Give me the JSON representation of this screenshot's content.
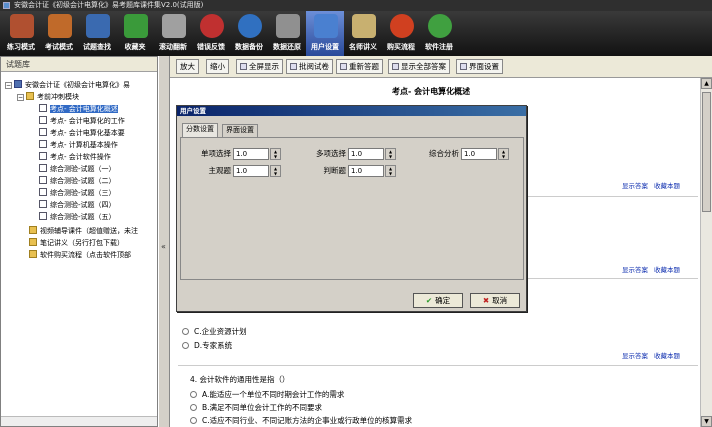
{
  "window": {
    "title": "安徽会计证《初级会计电算化》易考题库课件集V2.0(试用版)"
  },
  "toolbar": {
    "items": [
      {
        "label": "练习模式",
        "icon": "books-icon",
        "color": "#b05030"
      },
      {
        "label": "考试模式",
        "icon": "exam-chair-icon",
        "color": "#c06a2a"
      },
      {
        "label": "试题查找",
        "icon": "search-magnifier-icon",
        "color": "#3a6ab0"
      },
      {
        "label": "收藏夹",
        "icon": "favorites-book-icon",
        "color": "#3a9a3a"
      },
      {
        "label": "滚动翻新",
        "icon": "scroll-refresh-icon",
        "color": "#a0a0a0"
      },
      {
        "label": "错误反馈",
        "icon": "error-feedback-icon",
        "color": "#c03030"
      },
      {
        "label": "数据备份",
        "icon": "globe-backup-icon",
        "color": "#3070c0"
      },
      {
        "label": "数据还原",
        "icon": "restore-arrows-icon",
        "color": "#909090"
      },
      {
        "label": "用户设置",
        "icon": "user-settings-icon",
        "color": "#4a80d0"
      },
      {
        "label": "名师讲义",
        "icon": "lecture-notes-icon",
        "color": "#c8b070"
      },
      {
        "label": "购买流程",
        "icon": "internet-explorer-icon",
        "color": "#d04020"
      },
      {
        "label": "软件注册",
        "icon": "users-register-icon",
        "color": "#40a040"
      }
    ]
  },
  "tree": {
    "title": "试题库",
    "nodes": [
      {
        "label": "安徽会计证《初级会计电算化》易",
        "type": "book",
        "indent": 0,
        "expand": "−"
      },
      {
        "label": "考前冲刺模块",
        "type": "folder",
        "indent": 1,
        "expand": "−"
      },
      {
        "label": "考点-  会计电算化概述",
        "type": "page",
        "indent": 2,
        "selected": true
      },
      {
        "label": "考点-  会计电算化的工作",
        "type": "page",
        "indent": 2
      },
      {
        "label": "考点-  会计电算化基本要",
        "type": "page",
        "indent": 2
      },
      {
        "label": "考点-  计算机基本操作",
        "type": "page",
        "indent": 2
      },
      {
        "label": "考点-  会计软件操作",
        "type": "page",
        "indent": 2
      },
      {
        "label": "综合测验-试题（一）",
        "type": "page",
        "indent": 2
      },
      {
        "label": "综合测验-试题（二）",
        "type": "page",
        "indent": 2
      },
      {
        "label": "综合测验-试题（三）",
        "type": "page",
        "indent": 2
      },
      {
        "label": "综合测验-试题（四）",
        "type": "page",
        "indent": 2
      },
      {
        "label": "综合测验-试题（五）",
        "type": "page",
        "indent": 2
      },
      {
        "label": "视频辅导课件（超值赠送，未注",
        "type": "folder",
        "indent": 1
      },
      {
        "label": "笔记讲义（另行打包下载）",
        "type": "folder",
        "indent": 1
      },
      {
        "label": "软件购买流程（点击软件顶部",
        "type": "folder",
        "indent": 1
      }
    ]
  },
  "splitter": {
    "glyph": "«"
  },
  "content_toolbar": {
    "buttons": [
      {
        "label": "放大",
        "icon": ""
      },
      {
        "label": "缩小",
        "icon": ""
      },
      {
        "label": "全屏显示",
        "icon": "fullscreen-icon"
      },
      {
        "label": "批阅试卷",
        "icon": "grade-paper-icon"
      },
      {
        "label": "重新答题",
        "icon": "redo-answer-icon"
      },
      {
        "label": "显示全部答案",
        "icon": "show-answers-icon"
      },
      {
        "label": "界面设置",
        "icon": "interface-settings-icon"
      }
    ]
  },
  "doc": {
    "title": "考点-  会计电算化概述",
    "links": {
      "show_answer": "显示答案",
      "favorite": "收藏本题"
    },
    "q3_options": [
      {
        "text": "C.企业资源计划"
      },
      {
        "text": "D.专家系统"
      }
    ],
    "q4": {
      "text": "4. 会计软件的通用性是指（）",
      "options": [
        {
          "text": "A.能适应一个单位不同时期会计工作的需求"
        },
        {
          "text": "B.满足不同单位会计工作的不同要求"
        },
        {
          "text": "C.适应不同行业、不同记账方法的企事业或行政单位的核算需求"
        }
      ]
    }
  },
  "dialog": {
    "title": "用户设置",
    "tabs": [
      "分数设置",
      "界面设置"
    ],
    "fields": [
      {
        "label": "单项选择",
        "value": "1.0"
      },
      {
        "label": "多项选择",
        "value": "1.0"
      },
      {
        "label": "综合分析",
        "value": "1.0"
      },
      {
        "label": "主观题",
        "value": "1.0"
      },
      {
        "label": "判断题",
        "value": "1.0"
      }
    ],
    "ok_label": "确定",
    "cancel_label": "取消"
  },
  "colors": {
    "selection": "#316ac5",
    "link": "#1030b0",
    "dialog_title": "#0a246a"
  }
}
